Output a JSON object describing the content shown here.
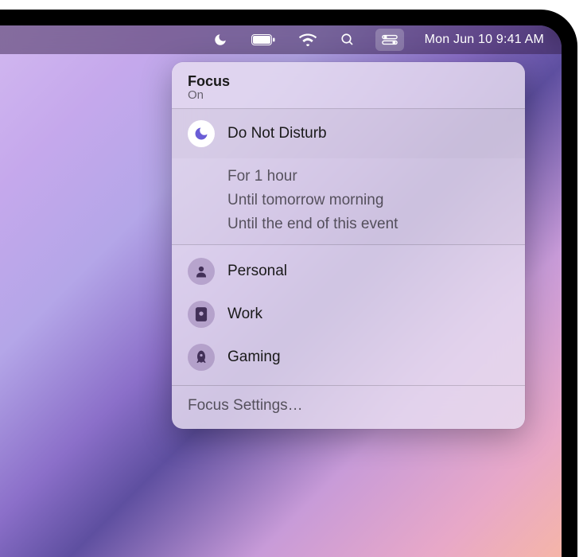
{
  "menubar": {
    "datetime": "Mon Jun 10  9:41 AM"
  },
  "panel": {
    "title": "Focus",
    "subtitle": "On",
    "dnd_label": "Do Not Disturb",
    "durations": [
      "For 1 hour",
      "Until tomorrow morning",
      "Until the end of this event"
    ],
    "modes": [
      {
        "label": "Personal",
        "icon": "person-icon"
      },
      {
        "label": "Work",
        "icon": "badge-icon"
      },
      {
        "label": "Gaming",
        "icon": "rocket-icon"
      }
    ],
    "settings_label": "Focus Settings…"
  },
  "colors": {
    "dnd_active_icon": "#6a5dd6",
    "mode_icon": "#423058"
  }
}
